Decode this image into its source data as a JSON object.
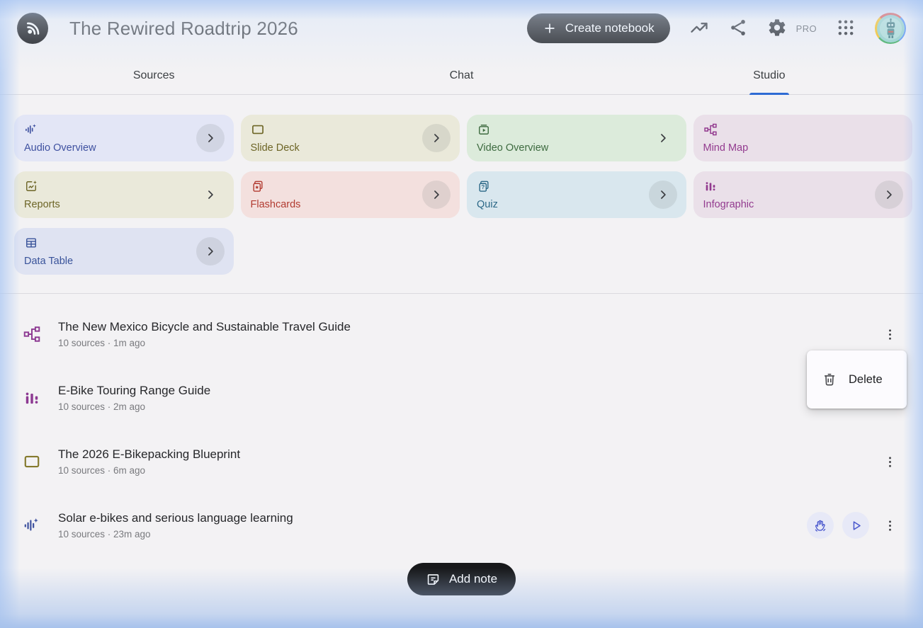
{
  "header": {
    "title": "The Rewired Roadtrip 2026",
    "create_button": "Create notebook",
    "pro_label": "PRO"
  },
  "tabs": [
    {
      "label": "Sources",
      "active": false
    },
    {
      "label": "Chat",
      "active": false
    },
    {
      "label": "Studio",
      "active": true
    }
  ],
  "studio_cards": [
    {
      "label": "Audio Overview",
      "icon": "audio-waveform-icon",
      "bg": "#e3e6f6",
      "fg": "#3f51a0",
      "chevron": "circle"
    },
    {
      "label": "Slide Deck",
      "icon": "slide-deck-icon",
      "bg": "#eae9da",
      "fg": "#6d6526",
      "chevron": "circle"
    },
    {
      "label": "Video Overview",
      "icon": "video-overview-icon",
      "bg": "#dcebdb",
      "fg": "#3e6b40",
      "chevron": "plain"
    },
    {
      "label": "Mind Map",
      "icon": "mind-map-icon",
      "bg": "#eae0e9",
      "fg": "#933b8f",
      "chevron": "none"
    },
    {
      "label": "Reports",
      "icon": "reports-icon",
      "bg": "#eae9da",
      "fg": "#6d6526",
      "chevron": "plain"
    },
    {
      "label": "Flashcards",
      "icon": "flashcards-icon",
      "bg": "#f3e0de",
      "fg": "#b23b31",
      "chevron": "circle"
    },
    {
      "label": "Quiz",
      "icon": "quiz-icon",
      "bg": "#d9e7ee",
      "fg": "#2c6887",
      "chevron": "circle"
    },
    {
      "label": "Infographic",
      "icon": "infographic-icon",
      "bg": "#eae0e9",
      "fg": "#933b8f",
      "chevron": "circle"
    },
    {
      "label": "Data Table",
      "icon": "data-table-icon",
      "bg": "#dfe3f2",
      "fg": "#39539a",
      "chevron": "circle"
    }
  ],
  "studio_items": [
    {
      "icon": "mind-map-icon",
      "icon_color": "#8d3a92",
      "title": "The New Mexico Bicycle and Sustainable Travel Guide",
      "meta": "10 sources · 1m ago",
      "controls": [],
      "menu": true
    },
    {
      "icon": "infographic-icon",
      "icon_color": "#8d3a92",
      "title": "E-Bike Touring Range Guide",
      "meta": "10 sources · 2m ago",
      "controls": [],
      "menu": true
    },
    {
      "icon": "slide-deck-icon",
      "icon_color": "#857a2d",
      "title": "The 2026 E-Bikepacking Blueprint",
      "meta": "10 sources · 6m ago",
      "controls": [],
      "menu": true
    },
    {
      "icon": "audio-waveform-icon",
      "icon_color": "#3b4f9d",
      "title": "Solar e-bikes and serious language learning",
      "meta": "10 sources · 23m ago",
      "controls": [
        "interactive-mode",
        "play"
      ],
      "menu": true
    }
  ],
  "context_menu": {
    "items": [
      {
        "icon": "trash-icon",
        "label": "Delete"
      }
    ]
  },
  "footer": {
    "add_note_label": "Add note"
  },
  "colors": {
    "accent_blue": "#2e6bd4",
    "pill_black": "#17181a",
    "edge_glow_blue": "#a7c2ec",
    "control_bg": "#e7e9f7",
    "control_fg": "#4856cd"
  }
}
